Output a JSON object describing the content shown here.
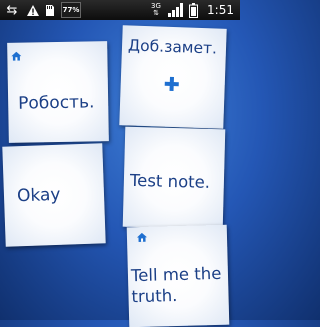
{
  "status_bar": {
    "battery_app_label": "77%",
    "network_type": "3G",
    "time": "1:51",
    "icons": [
      "usb-icon",
      "warning-icon",
      "sd-card-icon",
      "battery-app-icon",
      "data-arrows-icon",
      "signal-icon",
      "battery-icon"
    ]
  },
  "colors": {
    "note_text": "#1b3f86",
    "accent": "#1e6fd0",
    "background": "#2457b5"
  },
  "notes": [
    {
      "text": "Робость.",
      "pinned_home": true
    },
    {
      "text": "Доб.замет.",
      "is_add_button": true,
      "icon": "plus-icon"
    },
    {
      "text": "Okay"
    },
    {
      "text": "Test note."
    },
    {
      "text": "Tell me the truth.",
      "pinned_home": true
    }
  ]
}
